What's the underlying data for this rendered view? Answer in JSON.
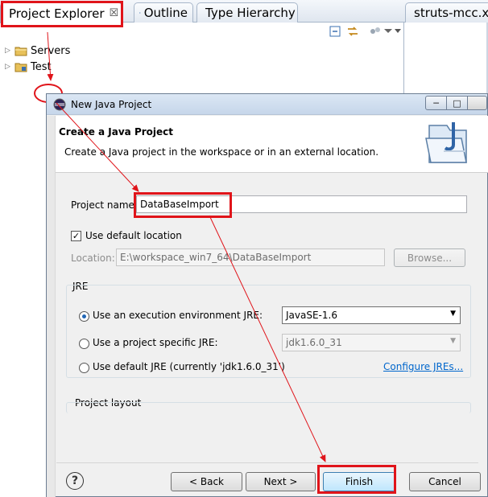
{
  "tabs": [
    {
      "label": "Project Explorer",
      "close": "☒"
    },
    {
      "label": "Outline"
    },
    {
      "label": "Type Hierarchy"
    },
    {
      "label": "struts-mcc.x"
    }
  ],
  "tree": [
    {
      "label": "Servers"
    },
    {
      "label": "Test"
    }
  ],
  "dialog": {
    "title": "New Java Project",
    "banner_title": "Create a Java Project",
    "banner_desc": "Create a Java project in the workspace or in an external location.",
    "project_name_label": "Project name:",
    "project_name_value": "DataBaseImport",
    "use_default_location": "Use default location",
    "location_label": "Location:",
    "location_value": "E:\\workspace_win7_64\\DataBaseImport",
    "browse": "Browse...",
    "jre_group": "JRE",
    "jre_options": [
      "Use an execution environment JRE:",
      "Use a project specific JRE:",
      "Use default JRE (currently 'jdk1.6.0_31')"
    ],
    "exec_env_value": "JavaSE-1.6",
    "specific_jre_value": "jdk1.6.0_31",
    "configure_jres": "Configure JREs...",
    "project_layout_group": "Project layout",
    "help": "?",
    "back": "< Back",
    "next": "Next >",
    "finish": "Finish",
    "cancel": "Cancel"
  },
  "colors": {
    "annotation_red": "#e0141a",
    "link_blue": "#0066cc",
    "radio_blue": "#2166b5"
  }
}
